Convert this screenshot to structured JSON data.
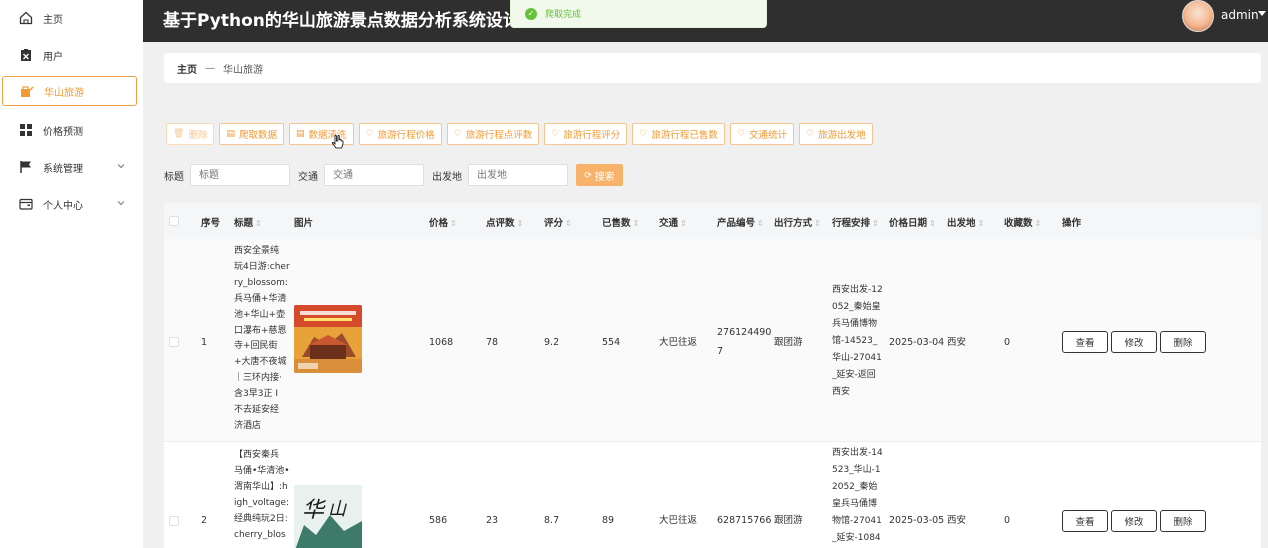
{
  "sidebar": {
    "items": [
      {
        "label": "主页",
        "icon": "home-icon"
      },
      {
        "label": "用户",
        "icon": "user-clipboard-icon"
      },
      {
        "label": "华山旅游",
        "icon": "travel-icon",
        "active": true
      },
      {
        "label": "价格预测",
        "icon": "grid-icon"
      },
      {
        "label": "系统管理",
        "icon": "flag-icon",
        "expandable": true
      },
      {
        "label": "个人中心",
        "icon": "wallet-icon",
        "expandable": true
      }
    ]
  },
  "header": {
    "title": "基于Python的华山旅游景点数据分析系统设计与实现",
    "user": "admin"
  },
  "toast": {
    "message": "爬取完成",
    "color": "#67c23a"
  },
  "breadcrumb": {
    "home": "主页",
    "separator": "—",
    "current": "华山旅游"
  },
  "toolbar": {
    "buttons": [
      {
        "label": "删除",
        "icon": "trash-icon",
        "disabled": true
      },
      {
        "label": "爬取数据",
        "icon": "doc-icon"
      },
      {
        "label": "数据清洗",
        "icon": "doc-icon"
      },
      {
        "label": "旅游行程价格",
        "icon": "heart-icon"
      },
      {
        "label": "旅游行程点评数",
        "icon": "heart-icon"
      },
      {
        "label": "旅游行程评分",
        "icon": "heart-icon"
      },
      {
        "label": "旅游行程已售数",
        "icon": "heart-icon"
      },
      {
        "label": "交通统计",
        "icon": "heart-icon"
      },
      {
        "label": "旅游出发地",
        "icon": "heart-icon"
      }
    ]
  },
  "search": {
    "title_label": "标题",
    "title_placeholder": "标题",
    "traffic_label": "交通",
    "traffic_placeholder": "交通",
    "origin_label": "出发地",
    "origin_placeholder": "出发地",
    "button": "搜索"
  },
  "table": {
    "columns": [
      "序号",
      "标题",
      "图片",
      "价格",
      "点评数",
      "评分",
      "已售数",
      "交通",
      "产品编号",
      "出行方式",
      "行程安排",
      "价格日期",
      "出发地",
      "收藏数",
      "操作"
    ],
    "rows": [
      {
        "index": "1",
        "title_lines": [
          "西安全景纯",
          "玩4日游:cher",
          "ry_blossom:",
          "兵马俑+华清",
          "池+华山+壶",
          "口瀑布+慈恩",
          "寺+回民街",
          "+大唐不夜城",
          "｜三环内接·",
          "含3早3正 I",
          "不去延安经",
          "济酒店"
        ],
        "price": "1068",
        "reviews": "78",
        "score": "9.2",
        "sold": "554",
        "traffic": "大巴往返",
        "product_lines": [
          "276124490",
          "7"
        ],
        "mode": "跟团游",
        "itinerary_lines": [
          "西安出发-12",
          "052_秦始皇",
          "兵马俑博物",
          "馆-14523_",
          "华山-27041",
          "_延安-返回",
          "西安"
        ],
        "date": "2025-03-04",
        "origin": "西安",
        "favorites": "0"
      },
      {
        "index": "2",
        "title_lines": [
          "【西安秦兵",
          "马俑•华清池•",
          "渭南华山】:h",
          "igh_voltage:",
          "经典纯玩2日:",
          "cherry_blos"
        ],
        "price": "586",
        "reviews": "23",
        "score": "8.7",
        "sold": "89",
        "traffic": "大巴往返",
        "product_lines": [
          "628715766"
        ],
        "mode": "跟团游",
        "itinerary_lines": [
          "西安出发-14",
          "523_华山-1",
          "2052_秦始",
          "皇兵马俑博",
          "物馆-27041",
          "_延安-1084"
        ],
        "date": "2025-03-05",
        "origin": "西安",
        "favorites": "0"
      }
    ],
    "actions": [
      "查看",
      "修改",
      "删除"
    ]
  }
}
